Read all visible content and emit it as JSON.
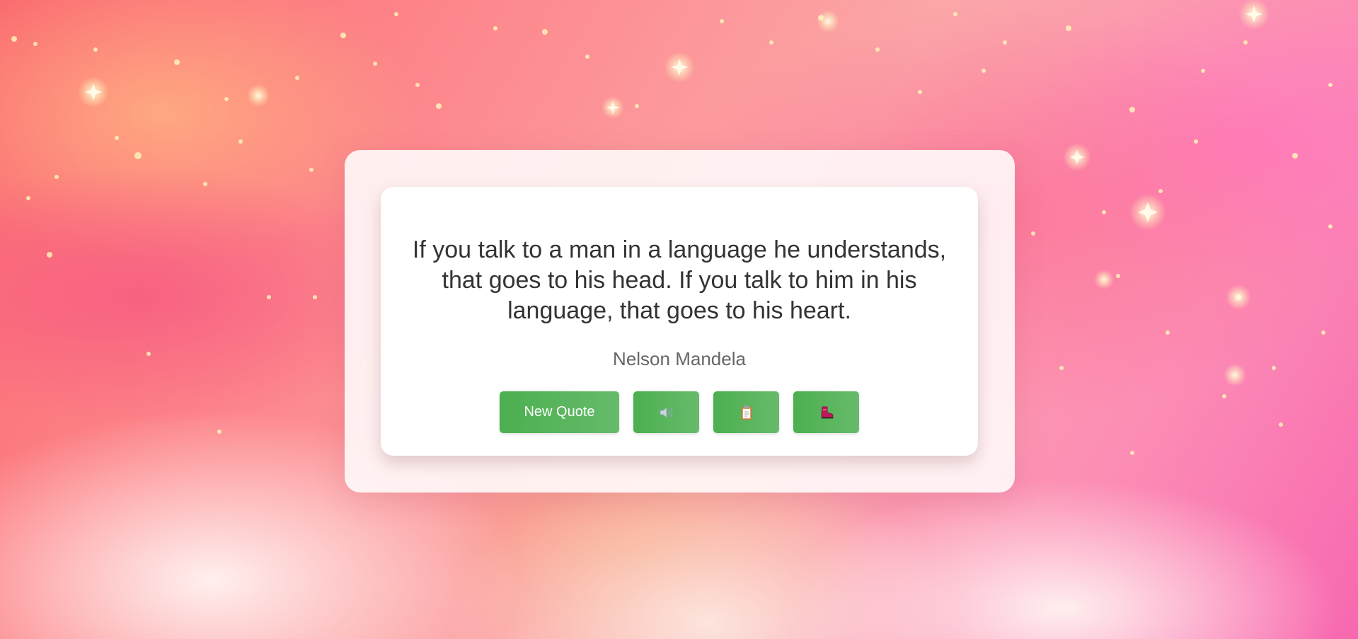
{
  "quote": {
    "text": "If you talk to a man in a language he understands, that goes to his head. If you talk to him in his language, that goes to his heart.",
    "author": "Nelson Mandela"
  },
  "buttons": {
    "new_quote_label": "New Quote",
    "speak_icon": "speaker-icon",
    "copy_icon": "clipboard-icon",
    "share_icon": "boot-icon"
  },
  "colors": {
    "button_green": "#4caf50",
    "button_green_light": "#66bb6a",
    "quote_text": "#333333",
    "author_text": "#666666"
  }
}
